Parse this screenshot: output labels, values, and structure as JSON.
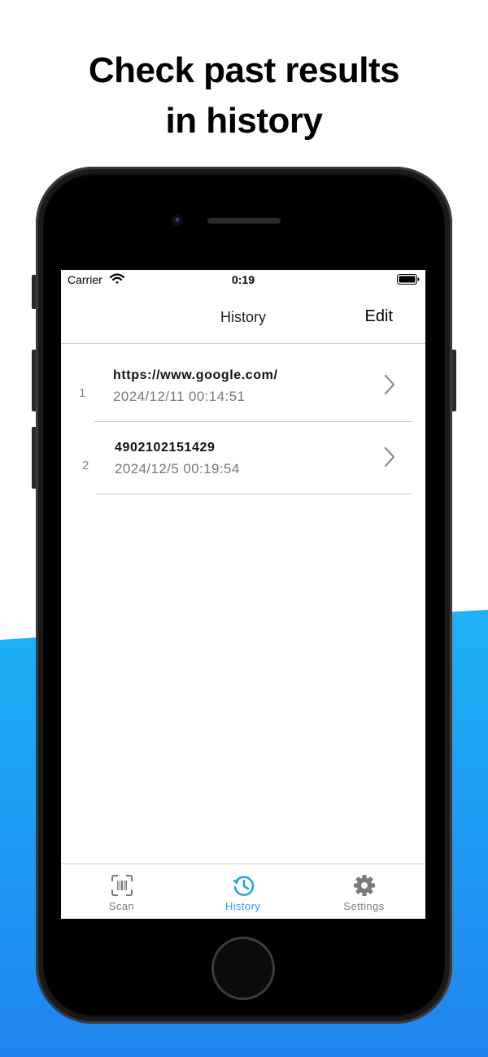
{
  "headline": {
    "line1": "Check past results",
    "line2": "in history"
  },
  "colors": {
    "accent": "#29a3e4",
    "wave_top": "#1eb2f7",
    "wave_bottom": "#1f87ef",
    "inactive": "#7a7a7a"
  },
  "status_bar": {
    "carrier": "Carrier",
    "time": "0:19"
  },
  "nav": {
    "title": "History",
    "edit_label": "Edit"
  },
  "history": [
    {
      "index": "1",
      "title": "https://www.google.com/",
      "date": "2024/12/11 00:14:51"
    },
    {
      "index": "2",
      "title": "4902102151429",
      "date": "2024/12/5 00:19:54"
    }
  ],
  "tabs": [
    {
      "label": "Scan",
      "icon": "barcode-scan-icon",
      "active": false
    },
    {
      "label": "History",
      "icon": "history-clock-icon",
      "active": true
    },
    {
      "label": "Settings",
      "icon": "gear-icon",
      "active": false
    }
  ]
}
